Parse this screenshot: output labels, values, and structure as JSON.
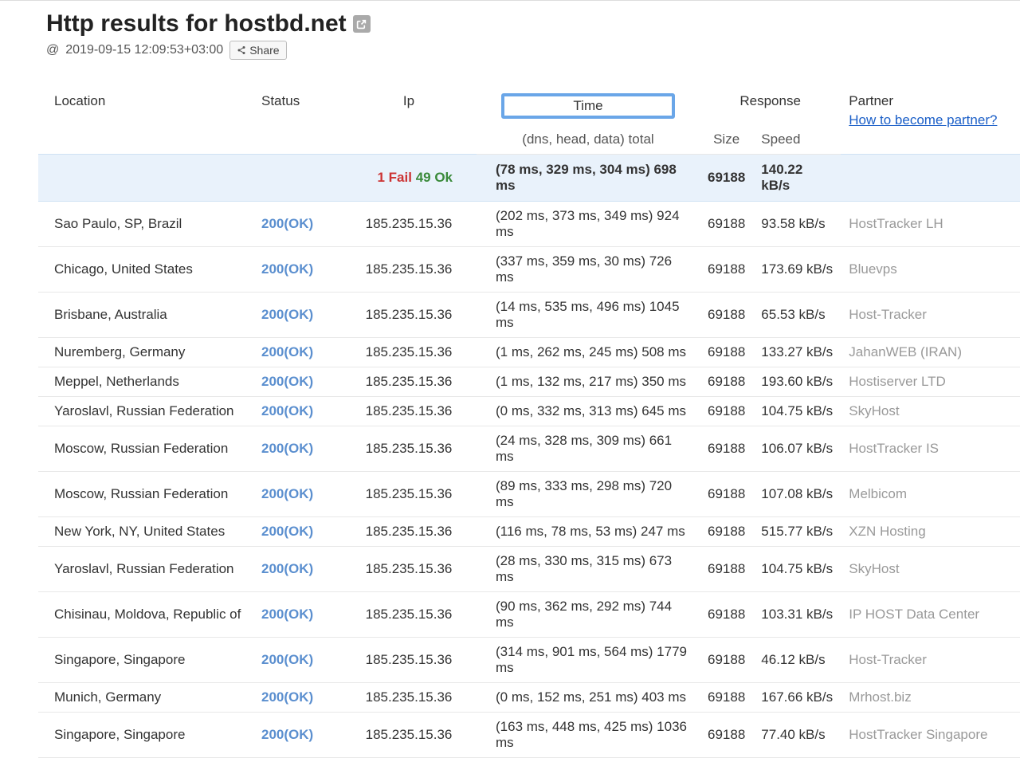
{
  "header": {
    "title": "Http results for hostbd.net",
    "timestamp_prefix": "@",
    "timestamp": "2019-09-15 12:09:53+03:00",
    "share_label": "Share"
  },
  "table": {
    "headers": {
      "location": "Location",
      "status": "Status",
      "ip": "Ip",
      "time": "Time",
      "time_sub": "(dns, head, data) total",
      "response": "Response",
      "size": "Size",
      "speed": "Speed",
      "partner": "Partner",
      "partner_link": "How to become partner?"
    },
    "summary": {
      "fail_count": "1 Fail",
      "ok_count": "49 Ok",
      "time": "(78 ms, 329 ms, 304 ms) 698 ms",
      "size": "69188",
      "speed": "140.22 kB/s"
    },
    "rows": [
      {
        "location": "Sao Paulo, SP, Brazil",
        "status": "200(OK)",
        "ip": "185.235.15.36",
        "time": "(202 ms, 373 ms, 349 ms) 924 ms",
        "size": "69188",
        "speed": "93.58 kB/s",
        "partner": "HostTracker LH"
      },
      {
        "location": "Chicago, United States",
        "status": "200(OK)",
        "ip": "185.235.15.36",
        "time": "(337 ms, 359 ms, 30 ms) 726 ms",
        "size": "69188",
        "speed": "173.69 kB/s",
        "partner": "Bluevps"
      },
      {
        "location": "Brisbane, Australia",
        "status": "200(OK)",
        "ip": "185.235.15.36",
        "time": "(14 ms, 535 ms, 496 ms) 1045 ms",
        "size": "69188",
        "speed": "65.53 kB/s",
        "partner": "Host-Tracker"
      },
      {
        "location": "Nuremberg, Germany",
        "status": "200(OK)",
        "ip": "185.235.15.36",
        "time": "(1 ms, 262 ms, 245 ms) 508 ms",
        "size": "69188",
        "speed": "133.27 kB/s",
        "partner": "JahanWEB (IRAN)"
      },
      {
        "location": "Meppel, Netherlands",
        "status": "200(OK)",
        "ip": "185.235.15.36",
        "time": "(1 ms, 132 ms, 217 ms) 350 ms",
        "size": "69188",
        "speed": "193.60 kB/s",
        "partner": "Hostiserver LTD"
      },
      {
        "location": "Yaroslavl, Russian Federation",
        "status": "200(OK)",
        "ip": "185.235.15.36",
        "time": "(0 ms, 332 ms, 313 ms) 645 ms",
        "size": "69188",
        "speed": "104.75 kB/s",
        "partner": "SkyHost"
      },
      {
        "location": "Moscow, Russian Federation",
        "status": "200(OK)",
        "ip": "185.235.15.36",
        "time": "(24 ms, 328 ms, 309 ms) 661 ms",
        "size": "69188",
        "speed": "106.07 kB/s",
        "partner": "HostTracker IS"
      },
      {
        "location": "Moscow, Russian Federation",
        "status": "200(OK)",
        "ip": "185.235.15.36",
        "time": "(89 ms, 333 ms, 298 ms) 720 ms",
        "size": "69188",
        "speed": "107.08 kB/s",
        "partner": "Melbicom"
      },
      {
        "location": "New York, NY, United States",
        "status": "200(OK)",
        "ip": "185.235.15.36",
        "time": "(116 ms, 78 ms, 53 ms) 247 ms",
        "size": "69188",
        "speed": "515.77 kB/s",
        "partner": "XZN Hosting"
      },
      {
        "location": "Yaroslavl, Russian Federation",
        "status": "200(OK)",
        "ip": "185.235.15.36",
        "time": "(28 ms, 330 ms, 315 ms) 673 ms",
        "size": "69188",
        "speed": "104.75 kB/s",
        "partner": "SkyHost"
      },
      {
        "location": "Chisinau, Moldova, Republic of",
        "status": "200(OK)",
        "ip": "185.235.15.36",
        "time": "(90 ms, 362 ms, 292 ms) 744 ms",
        "size": "69188",
        "speed": "103.31 kB/s",
        "partner": "IP HOST Data Center"
      },
      {
        "location": "Singapore, Singapore",
        "status": "200(OK)",
        "ip": "185.235.15.36",
        "time": "(314 ms, 901 ms, 564 ms) 1779 ms",
        "size": "69188",
        "speed": "46.12 kB/s",
        "partner": "Host-Tracker"
      },
      {
        "location": "Munich, Germany",
        "status": "200(OK)",
        "ip": "185.235.15.36",
        "time": "(0 ms, 152 ms, 251 ms) 403 ms",
        "size": "69188",
        "speed": "167.66 kB/s",
        "partner": "Mrhost.biz"
      },
      {
        "location": "Singapore, Singapore",
        "status": "200(OK)",
        "ip": "185.235.15.36",
        "time": "(163 ms, 448 ms, 425 ms) 1036 ms",
        "size": "69188",
        "speed": "77.40 kB/s",
        "partner": "HostTracker Singapore"
      }
    ]
  }
}
